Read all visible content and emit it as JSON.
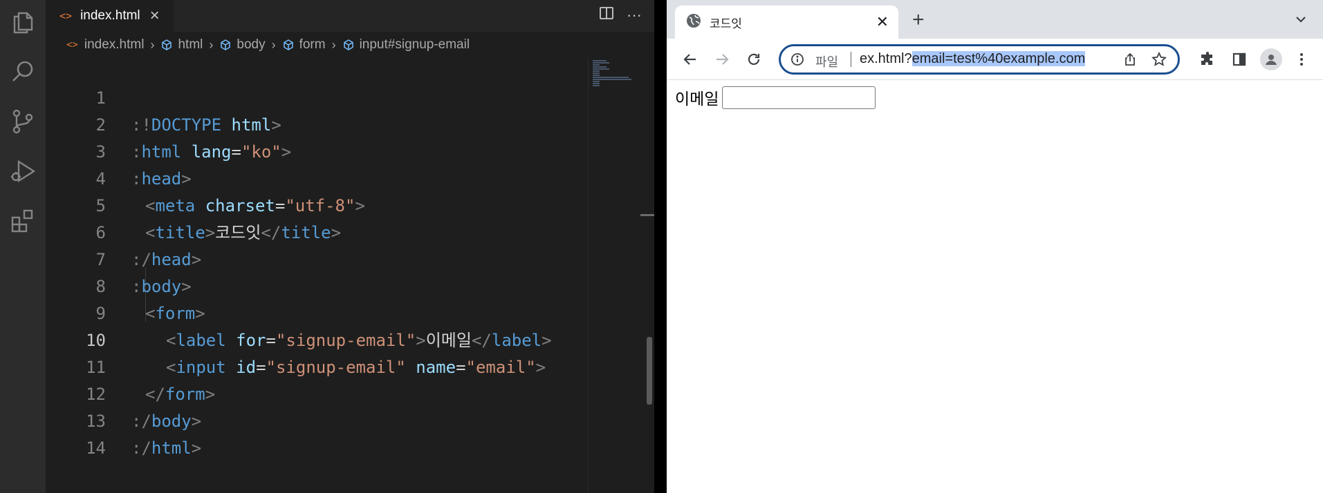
{
  "editor": {
    "tab_filename": "index.html",
    "breadcrumb": [
      "index.html",
      "html",
      "body",
      "form",
      "input#signup-email"
    ],
    "lines": [
      {
        "n": "1"
      },
      {
        "n": "2"
      },
      {
        "n": "3"
      },
      {
        "n": "4"
      },
      {
        "n": "5"
      },
      {
        "n": "6"
      },
      {
        "n": "7"
      },
      {
        "n": "8"
      },
      {
        "n": "9"
      },
      {
        "n": "10"
      },
      {
        "n": "11"
      },
      {
        "n": "12"
      },
      {
        "n": "13"
      },
      {
        "n": "14"
      }
    ],
    "active_line": "10",
    "code": {
      "doctype_kw": "DOCTYPE",
      "doctype_val": "html",
      "html_tag": "html",
      "lang_attr": "lang",
      "lang_val": "\"ko\"",
      "head_tag": "head",
      "meta_tag": "meta",
      "charset_attr": "charset",
      "charset_val": "\"utf-8\"",
      "title_tag": "title",
      "title_text": "코드잇",
      "body_tag": "body",
      "form_tag": "form",
      "label_tag": "label",
      "for_attr": "for",
      "for_val": "\"signup-email\"",
      "label_text": "이메일",
      "input_tag": "input",
      "id_attr": "id",
      "id_val": "\"signup-email\"",
      "name_attr": "name",
      "name_val": "\"email\""
    }
  },
  "browser": {
    "tab_title": "코드잇",
    "scheme_label": "파일",
    "url_prefix": "ex.html?",
    "url_selected": "email=test%40example.com",
    "page": {
      "label": "이메일",
      "input_value": ""
    }
  },
  "colors": {
    "keyword": "#569cd6",
    "attribute": "#9cdcfe",
    "string": "#ce9178",
    "omnibox_focus": "#1a4e8f",
    "url_selection": "#a8c7fa"
  },
  "icons": [
    "explorer-icon",
    "search-icon",
    "source-control-icon",
    "run-debug-icon",
    "extensions-icon",
    "split-editor-icon",
    "more-actions-icon",
    "globe-icon",
    "back-arrow-icon",
    "forward-arrow-icon",
    "reload-icon",
    "info-icon",
    "share-icon",
    "star-icon",
    "puzzle-icon",
    "side-panel-icon",
    "profile-icon",
    "kebab-menu-icon"
  ]
}
